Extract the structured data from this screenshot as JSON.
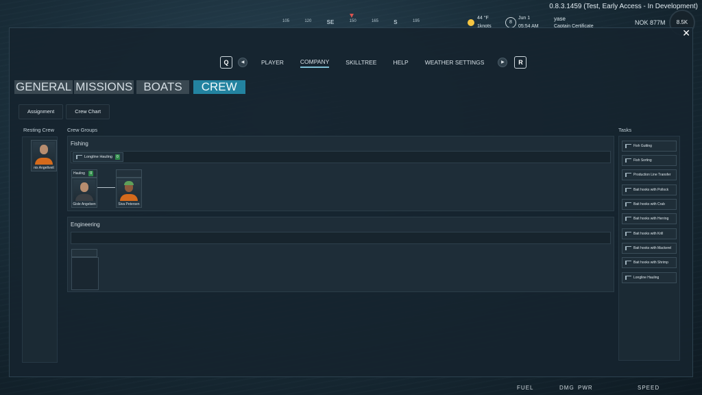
{
  "version": "0.8.3.1459 (Test, Early Access - In Development)",
  "hud": {
    "compass_ticks": [
      "105",
      "120",
      "SE",
      "150",
      "165",
      "S",
      "195"
    ],
    "temperature": "44 °F",
    "wind": "1knots",
    "boat_speed": "8",
    "date": "Jun 1",
    "time": "05:54 AM",
    "username": "yase",
    "certificate": "Captain Certificate",
    "money": "NOK 877M",
    "level": "8.5K"
  },
  "nav": {
    "left_key": "Q",
    "right_key": "R",
    "items": [
      "PLAYER",
      "COMPANY",
      "SKILLTREE",
      "HELP",
      "WEATHER SETTINGS"
    ],
    "active": "COMPANY"
  },
  "tabs": {
    "general": "GENERAL",
    "missions": "MISSIONS",
    "boats": "BOATS",
    "crew": "CREW"
  },
  "subtabs": {
    "assignment": "Assignment",
    "crew_chart": "Crew Chart"
  },
  "labels": {
    "resting_crew": "Resting Crew",
    "crew_groups": "Crew Groups",
    "tasks": "Tasks"
  },
  "resting_crew": [
    {
      "name": "nis Angeltveit"
    }
  ],
  "groups": {
    "fishing": {
      "title": "Fishing",
      "task_chip": "Longline Hauling",
      "task_count": "0",
      "slot_task": "Hauling",
      "slot_task_count": "0",
      "leader": "Gisle Angelsen",
      "member": "Siva Petersen"
    },
    "engineering": {
      "title": "Engineering"
    }
  },
  "task_list": [
    "Fish Gutting",
    "Fish Sorting",
    "Production Line Transfer",
    "Bait hooks with Pollock",
    "Bait hooks with Crab",
    "Bait hooks with Herring",
    "Bait hooks with Krill",
    "Bait hooks with Mackerel",
    "Bait hooks with Shrimp",
    "Longline Hauling"
  ],
  "bottom_hud": {
    "fuel": "FUEL",
    "dmg": "DMG",
    "pwr": "PWR",
    "speed": "SPEED"
  },
  "colors": {
    "accent": "#2383a0",
    "panel": "#16242e"
  }
}
